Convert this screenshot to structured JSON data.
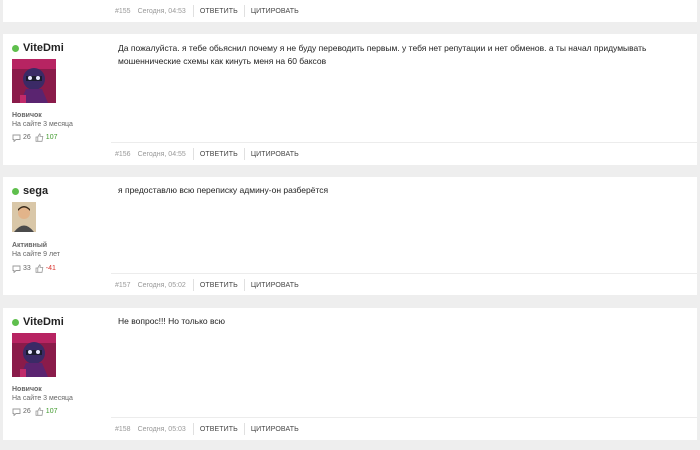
{
  "top_post": {
    "number": "#155",
    "date": "Сегодня, 04:53",
    "reply": "ОТВЕТИТЬ",
    "quote": "ЦИТИРОВАТЬ"
  },
  "posts": [
    {
      "username": "ViteDmi",
      "rank": "Новичок",
      "since": "На сайте 3 месяца",
      "comments": "26",
      "reputation": "107",
      "message": "Да пожалуйста. я тебе обьяснил почему я не буду переводить первым. у тебя нет репутации и нет обменов.   а ты начал придумывать мошеннические схемы как кинуть меня на 60 баксов",
      "number": "#156",
      "date": "Сегодня, 04:55",
      "reply": "ОТВЕТИТЬ",
      "quote": "ЦИТИРОВАТЬ"
    },
    {
      "username": "sega",
      "rank": "Активный",
      "since": "На сайте 9 лет",
      "comments": "33",
      "reputation": "-41",
      "message": "я предоставлю всю переписку админу-он разберётся",
      "number": "#157",
      "date": "Сегодня, 05:02",
      "reply": "ОТВЕТИТЬ",
      "quote": "ЦИТИРОВАТЬ"
    },
    {
      "username": "ViteDmi",
      "rank": "Новичок",
      "since": "На сайте 3 месяца",
      "comments": "26",
      "reputation": "107",
      "message": "Не вопрос!!! Но только всю",
      "number": "#158",
      "date": "Сегодня, 05:03",
      "reply": "ОТВЕТИТЬ",
      "quote": "ЦИТИРОВАТЬ"
    }
  ],
  "colors": {
    "online": "#5fbf4d",
    "rep_positive": "#3f9a2c",
    "rep_negative": "#d9312b"
  },
  "icons": {
    "comments": "comment-bubble-icon",
    "reputation": "thumbs-up-icon"
  }
}
